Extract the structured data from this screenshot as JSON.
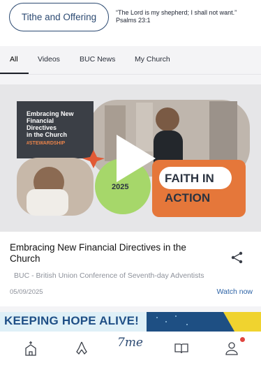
{
  "header": {
    "tithe_button": "Tithe and Offering",
    "verse": "“The Lord is my shepherd; I shall not want.” Psalms 23:1"
  },
  "tabs": [
    {
      "label": "All",
      "active": true
    },
    {
      "label": "Videos",
      "active": false
    },
    {
      "label": "BUC News",
      "active": false
    },
    {
      "label": "My Church",
      "active": false
    }
  ],
  "card": {
    "thumbnail": {
      "headline": [
        "Embracing New",
        "Financial",
        "Directives",
        "in the Church"
      ],
      "hashtag": "#STEWARDSHIP",
      "year": "2025",
      "slogan_line1": "FAITH IN",
      "slogan_line2": "ACTION"
    },
    "title": "Embracing New Financial Directives in the Church",
    "author": "BUC - British Union Conference of Seventh-day Adventists",
    "date": "05/09/2025",
    "watch_label": "Watch now"
  },
  "banner2": {
    "text": "KEEPING HOPE ALIVE!"
  },
  "bottom_nav": {
    "items": [
      "church-icon",
      "praying-hands-icon",
      "7me-logo",
      "book-icon",
      "profile-icon"
    ],
    "logo_text": "7me"
  },
  "colors": {
    "primary": "#2c4a72",
    "link": "#2d63a6",
    "orange": "#e5773a",
    "lime": "#a6d76a",
    "dark_panel": "#3b3f46",
    "notification": "#e0453f"
  }
}
